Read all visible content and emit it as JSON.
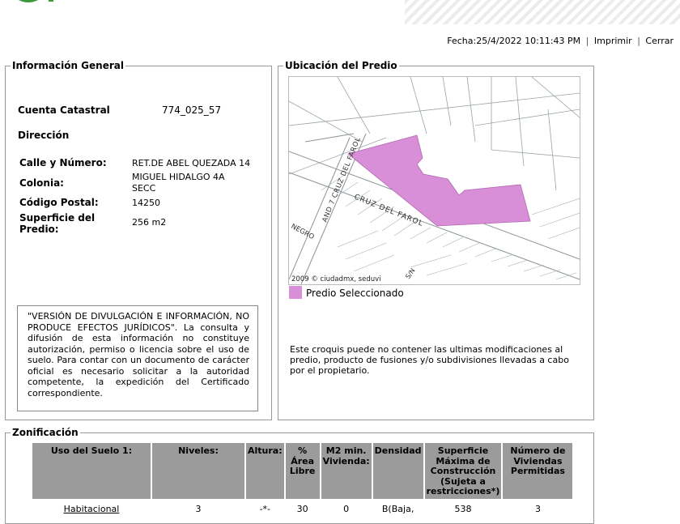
{
  "header": {
    "fecha_label": "Fecha:25/4/2022 10:11:43 PM",
    "separator": "|",
    "print_label": "Imprimir",
    "close_label": "Cerrar"
  },
  "general": {
    "legend": "Información General",
    "cuenta_label": "Cuenta Catastral",
    "cuenta_value": "774_025_57",
    "direccion_label": "Dirección",
    "calle_label": "Calle y Número:",
    "calle_value": "RET.DE ABEL QUEZADA 14",
    "colonia_label": "Colonia:",
    "colonia_value_1": "MIGUEL HIDALGO 4A",
    "colonia_value_2": "SECC",
    "cp_label": "Código Postal:",
    "cp_value": "14250",
    "superficie_label_1": "Superficie del",
    "superficie_label_2": "Predio:",
    "superficie_value": "256 m2",
    "disclaimer": "\"VERSIÓN DE DIVULGACIÓN E INFORMACIÓN, NO PRODUCE EFECTOS JURÍDICOS\". La consulta y difusión de esta información no constituye autorización, permiso o licencia sobre el uso de suelo. Para contar con un documento de carácter oficial es necesario solicitar a la autoridad competente, la expedición del Certificado correspondiente."
  },
  "ubicacion": {
    "legend": "Ubicación del Predio",
    "map_street_1": "AND 7 CRUZ DEL FAROL",
    "map_street_2": "CRUZ DEL FAROL",
    "map_street_3": "NEGRO",
    "map_street_4": "S/N",
    "map_credit": "2009 © ciudadmx, seduvi",
    "legend_item": "Predio Seleccionado",
    "note": "Este croquis puede no contener las ultimas modificaciones al predio, producto de fusiones y/o subdivisiones llevadas a cabo por el propietario.",
    "predio_color": "#d98ed8"
  },
  "zonificacion": {
    "legend": "Zonificación",
    "headers": [
      "Uso del Suelo 1:",
      "Niveles:",
      "Altura:",
      "% Área Libre",
      "M2 min. Vivienda:",
      "Densidad",
      "Superficie Máxima de Construcción (Sujeta a restricciones*)",
      "Número de Viviendas Permitidas"
    ],
    "row": [
      "Habitacional",
      "3",
      "-*-",
      "30",
      "0",
      "B(Baja,",
      "538",
      "3"
    ]
  }
}
